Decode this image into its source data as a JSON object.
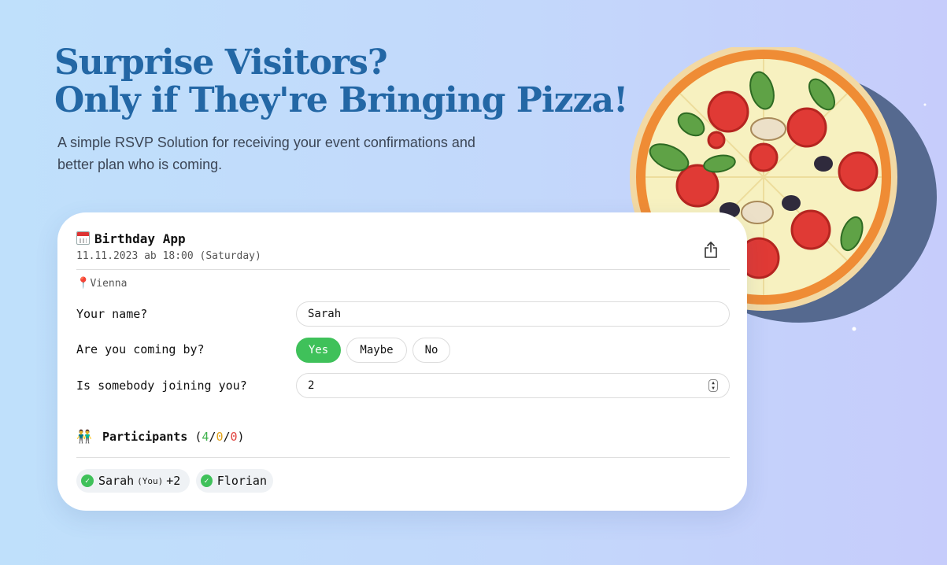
{
  "hero": {
    "title_line1": "Surprise Visitors?",
    "title_line2": "Only if They're Bringing Pizza!",
    "subtitle": "A simple RSVP Solution for receiving your event confirmations and better plan who is coming."
  },
  "event": {
    "title": "Birthday App",
    "date": "11.11.2023 ab 18:00 (Saturday)",
    "location": "Vienna"
  },
  "form": {
    "name_label": "Your name?",
    "name_value": "Sarah",
    "coming_label": "Are you coming by?",
    "options": [
      "Yes",
      "Maybe",
      "No"
    ],
    "selected_option": "Yes",
    "joining_label": "Is somebody joining you?",
    "joining_value": "2"
  },
  "participants": {
    "label": "Participants",
    "open_paren": "(",
    "sep": "/",
    "close_paren": ")",
    "yes_count": "4",
    "maybe_count": "0",
    "no_count": "0",
    "list": [
      {
        "name": "Sarah",
        "you_label": "(You)",
        "extra": "+2"
      },
      {
        "name": "Florian"
      }
    ]
  },
  "colors": {
    "accent_green": "#3fc15a",
    "title_blue": "#2367a5",
    "maybe_orange": "#e2a21a",
    "no_red": "#e0413d"
  },
  "icons": [
    "calendar-icon",
    "share-icon",
    "location-pin-icon",
    "people-icon",
    "check-icon",
    "stepper-icon",
    "pizza-illustration"
  ]
}
